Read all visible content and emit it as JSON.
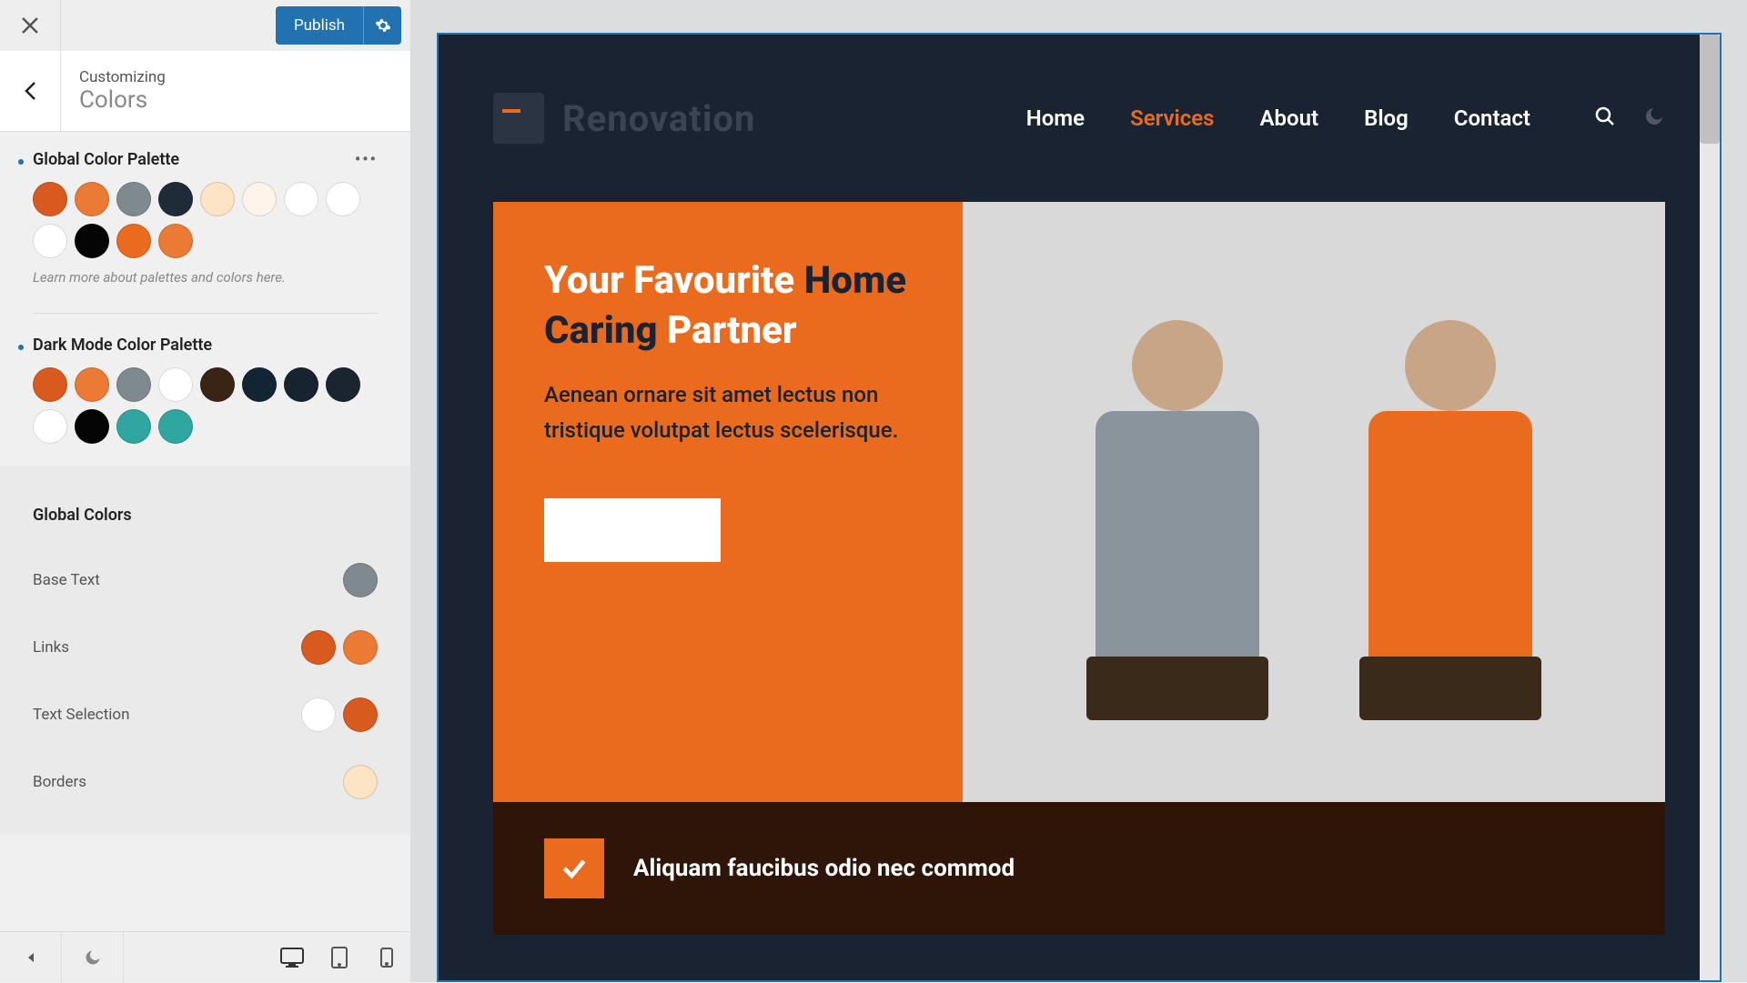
{
  "customizer": {
    "publish_label": "Publish",
    "breadcrumb_parent": "Customizing",
    "breadcrumb_title": "Colors",
    "sections": {
      "global_palette": {
        "title": "Global Color Palette",
        "colors": [
          "#d85a1f",
          "#ea7a34",
          "#7f8a90",
          "#1f2b38",
          "#fde4c4",
          "#fff4e9",
          "#ffffff",
          "#ffffff",
          "#ffffff",
          "#050505",
          "#ea6b1e",
          "#ea7a34"
        ],
        "hint": "Learn more about palettes and colors here."
      },
      "dark_palette": {
        "title": "Dark Mode Color Palette",
        "colors": [
          "#d85a1f",
          "#ea7a34",
          "#7f8a90",
          "#ffffff",
          "#3a2416",
          "#132434",
          "#17242f",
          "#1a2530",
          "#ffffff",
          "#050505",
          "#2fa6a0",
          "#2fa6a0"
        ]
      },
      "global_colors_heading": "Global Colors",
      "rows": [
        {
          "label": "Base Text",
          "chips": [
            "#7f8a90"
          ]
        },
        {
          "label": "Links",
          "chips": [
            "#d85a1f",
            "#ea7a34"
          ]
        },
        {
          "label": "Text Selection",
          "chips": [
            "#ffffff",
            "#d85a1f"
          ]
        },
        {
          "label": "Borders",
          "chips": [
            "#fde4c4"
          ]
        }
      ]
    }
  },
  "site": {
    "name": "Renovation",
    "nav": [
      {
        "label": "Home",
        "active": false
      },
      {
        "label": "Services",
        "active": true
      },
      {
        "label": "About",
        "active": false
      },
      {
        "label": "Blog",
        "active": false
      },
      {
        "label": "Contact",
        "active": false
      }
    ],
    "hero": {
      "title_p1": "Your Favourite ",
      "title_alt1": "Home",
      "title_alt2": "Caring",
      "title_p2": " Partner",
      "desc": "Aenean ornare sit amet lectus non tristique volutpat lectus scelerisque."
    },
    "feature": {
      "text": "Aliquam faucibus odio nec commod"
    }
  }
}
